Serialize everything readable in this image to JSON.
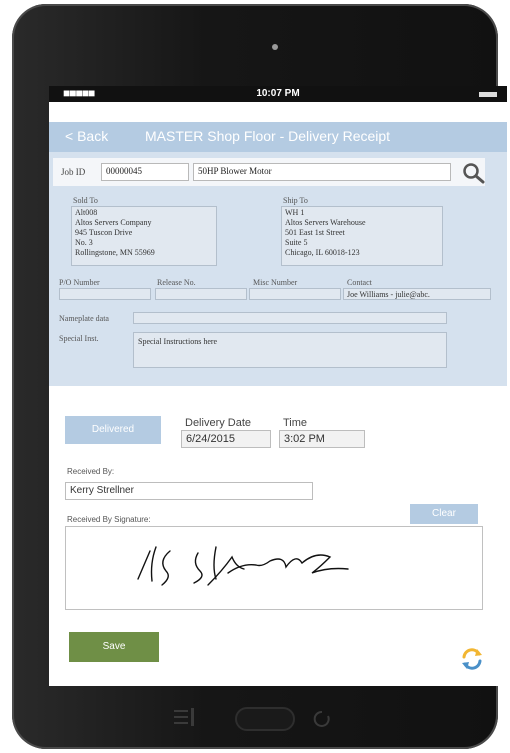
{
  "status": {
    "time": "10:07 PM"
  },
  "nav": {
    "back_label": "< Back",
    "title": "MASTER Shop Floor - Delivery Receipt"
  },
  "job": {
    "label": "Job ID",
    "id": "00000045",
    "description": "50HP Blower Motor"
  },
  "sold_to": {
    "label": "Sold To",
    "lines": [
      "Alt008",
      "Altos Servers Company",
      "945 Tuscon Drive",
      "No. 3",
      "Rollingstone, MN  55969"
    ]
  },
  "ship_to": {
    "label": "Ship To",
    "lines": [
      "WH 1",
      "Altos Servers Warehouse",
      "501 East 1st Street",
      "Suite 5",
      "Chicago, IL  60018-123"
    ]
  },
  "fields": {
    "po_label": "P/O Number",
    "po_value": "",
    "release_label": "Release No.",
    "release_value": "",
    "misc_label": "Misc Number",
    "misc_value": "",
    "contact_label": "Contact",
    "contact_value": "Joe Williams - julie@abc.",
    "nameplate_label": "Nameplate data",
    "nameplate_value": "",
    "special_label": "Special Inst.",
    "special_value": "Special Instructions here"
  },
  "delivery": {
    "status_button": "Delivered",
    "date_label": "Delivery Date",
    "date_value": "6/24/2015",
    "time_label": "Time",
    "time_value": "3:02 PM"
  },
  "received": {
    "label": "Received By:",
    "value": "Kerry Strellner"
  },
  "signature": {
    "label": "Received By Signature:",
    "clear_label": "Clear"
  },
  "actions": {
    "save_label": "Save"
  },
  "icons": [
    "search-icon",
    "refresh-icon",
    "camera-icon",
    "menu-icon",
    "home-button",
    "back-arrow-icon"
  ]
}
